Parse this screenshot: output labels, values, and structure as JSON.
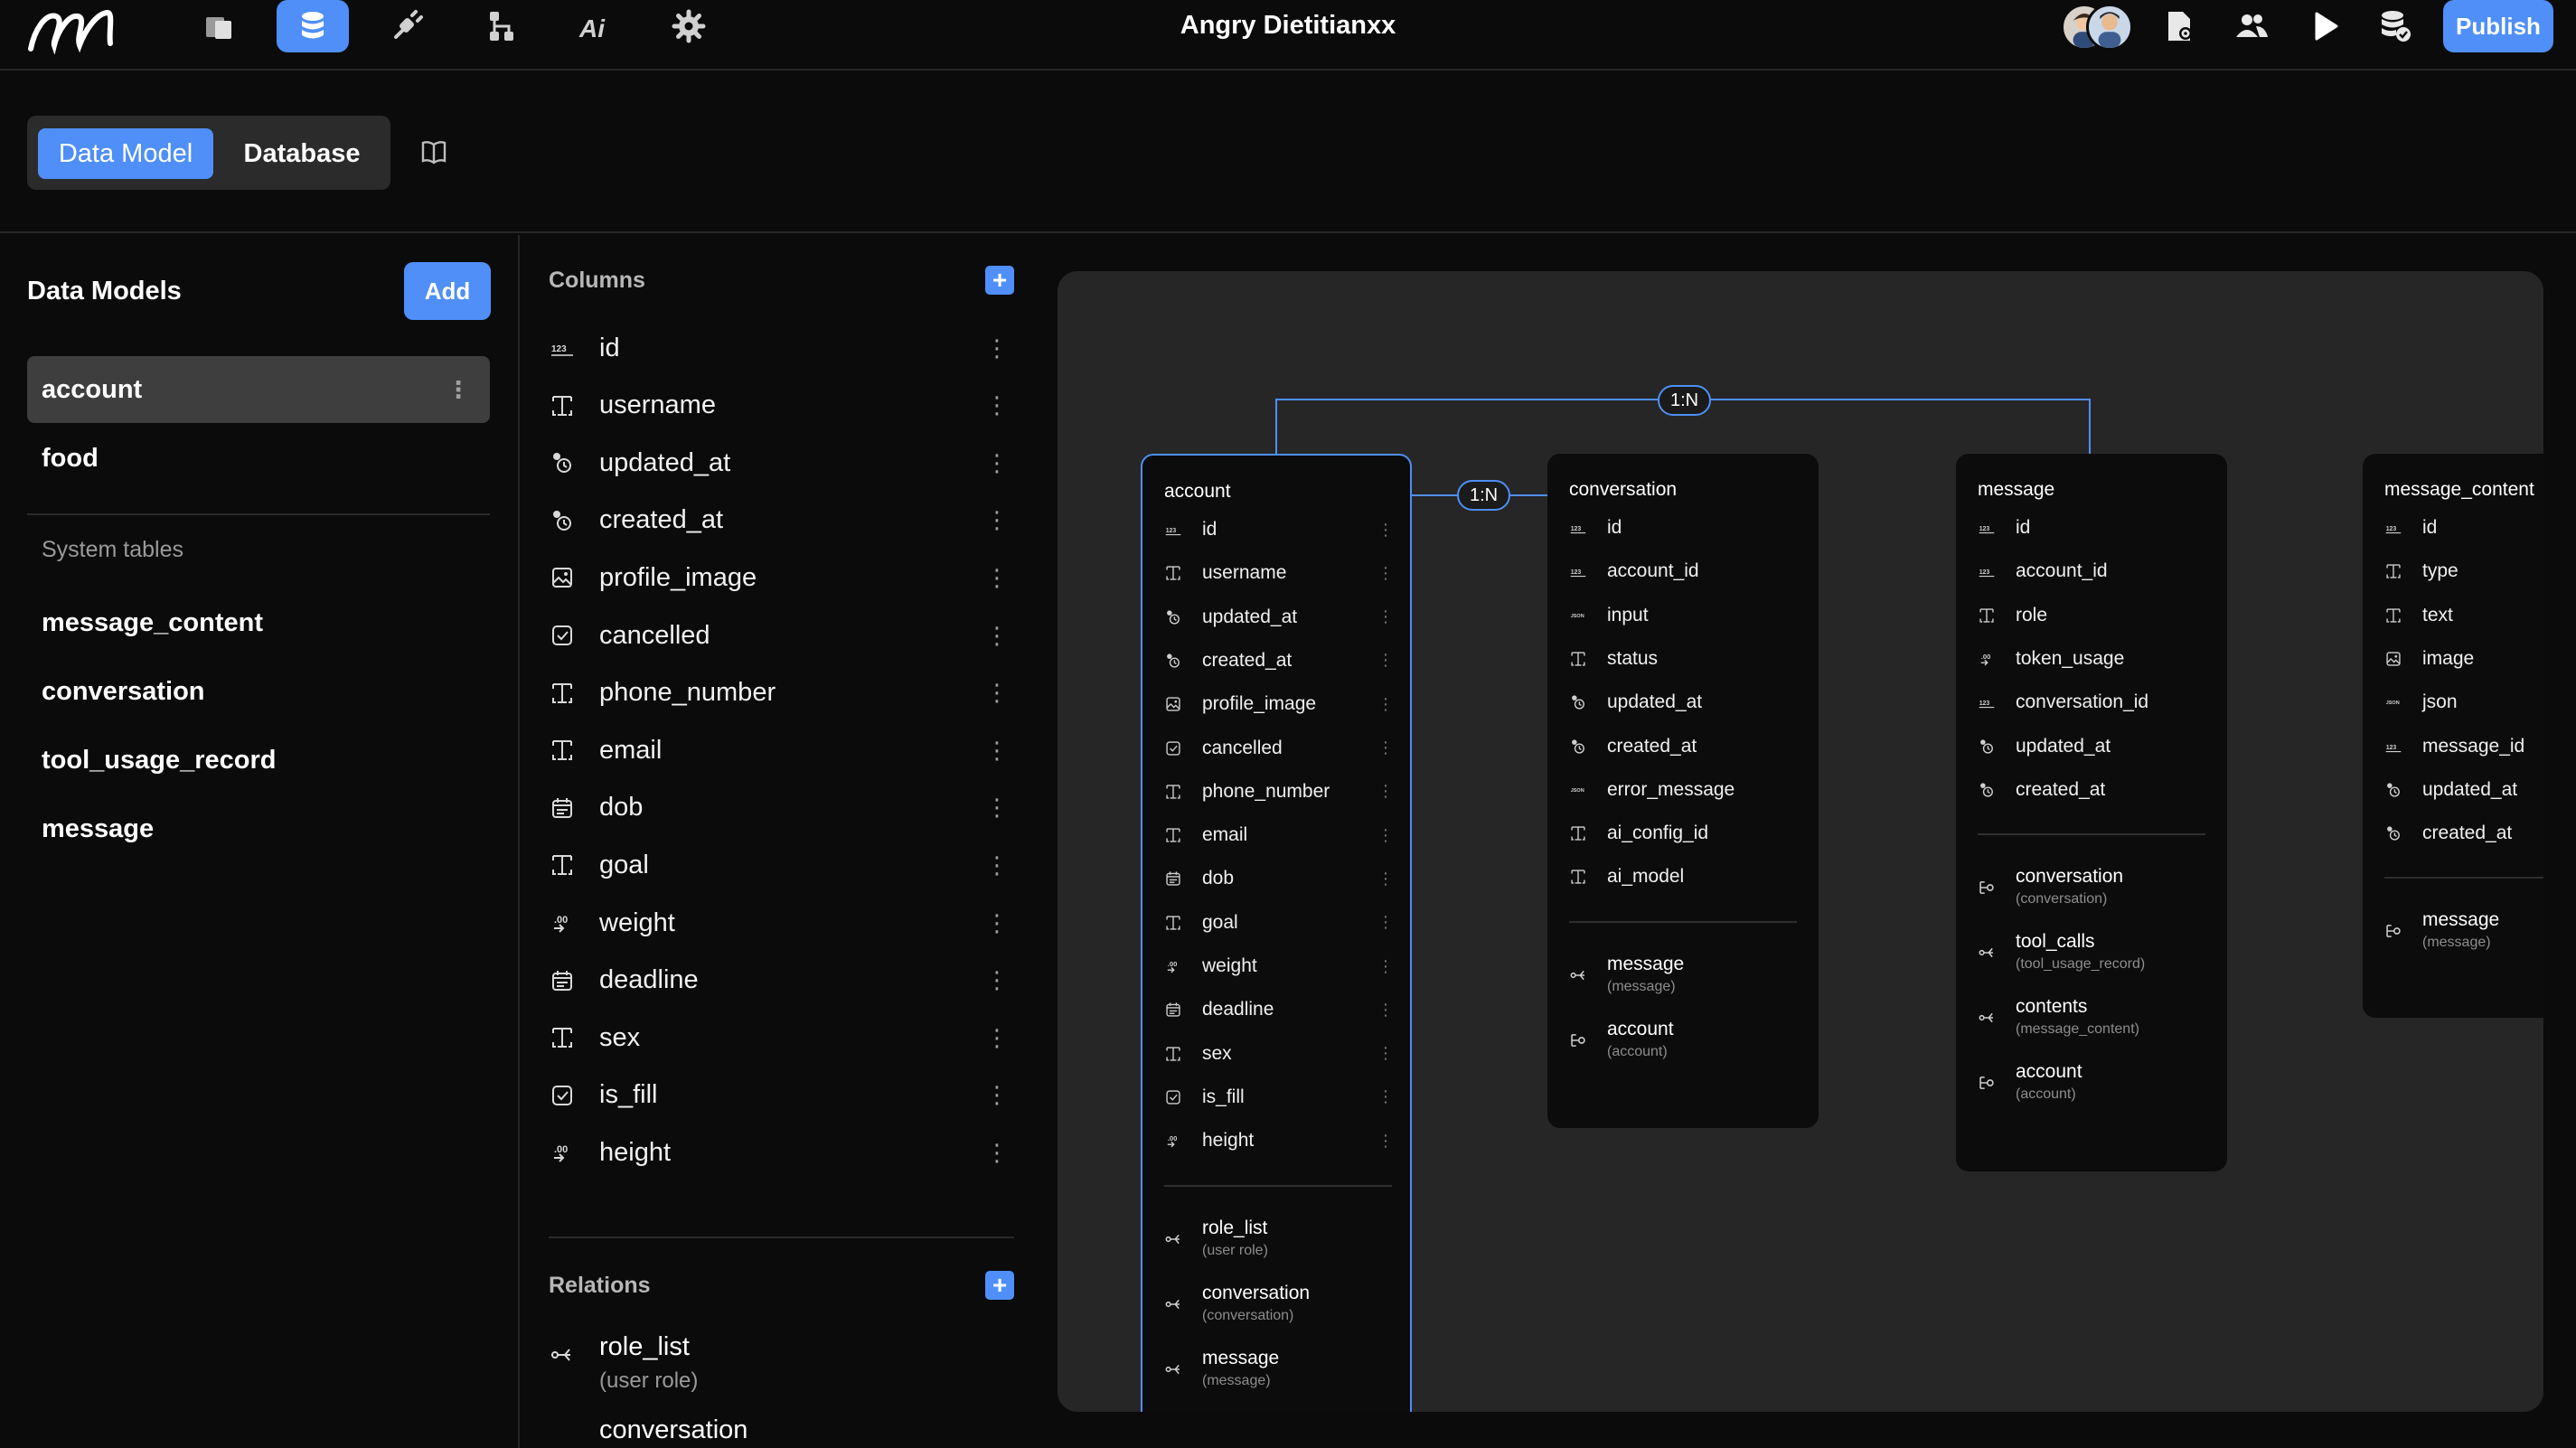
{
  "app": {
    "title": "Angry Dietitianxx",
    "publish_label": "Publish",
    "accent": "#4f8ff7"
  },
  "topbar": {
    "icons": [
      "pages-icon",
      "database-icon",
      "plug-icon",
      "workflow-icon",
      "ai-icon",
      "settings-icon"
    ],
    "right_icons": [
      "file-settings-icon",
      "users-icon",
      "play-icon",
      "database-check-icon"
    ]
  },
  "subheader": {
    "tab_data_model": "Data Model",
    "tab_database": "Database"
  },
  "models": {
    "title": "Data Models",
    "add_label": "Add",
    "items": [
      "account",
      "food"
    ],
    "system_label": "System tables",
    "system_items": [
      "message_content",
      "conversation",
      "tool_usage_record",
      "message"
    ]
  },
  "columns": {
    "title": "Columns",
    "items": [
      {
        "name": "id",
        "type": "number"
      },
      {
        "name": "username",
        "type": "text"
      },
      {
        "name": "updated_at",
        "type": "timestamp"
      },
      {
        "name": "created_at",
        "type": "timestamp"
      },
      {
        "name": "profile_image",
        "type": "image"
      },
      {
        "name": "cancelled",
        "type": "boolean"
      },
      {
        "name": "phone_number",
        "type": "text"
      },
      {
        "name": "email",
        "type": "text"
      },
      {
        "name": "dob",
        "type": "date"
      },
      {
        "name": "goal",
        "type": "text"
      },
      {
        "name": "weight",
        "type": "decimal"
      },
      {
        "name": "deadline",
        "type": "date"
      },
      {
        "name": "sex",
        "type": "text"
      },
      {
        "name": "is_fill",
        "type": "boolean"
      },
      {
        "name": "height",
        "type": "decimal"
      }
    ]
  },
  "relations": {
    "title": "Relations",
    "items": [
      {
        "name": "role_list",
        "target": "(user role)"
      },
      {
        "name": "conversation",
        "target": ""
      }
    ]
  },
  "diagram": {
    "badges": [
      "1:N",
      "1:N"
    ],
    "tables": [
      {
        "title": "account",
        "columns": [
          {
            "name": "id",
            "type": "number"
          },
          {
            "name": "username",
            "type": "text"
          },
          {
            "name": "updated_at",
            "type": "timestamp"
          },
          {
            "name": "created_at",
            "type": "timestamp"
          },
          {
            "name": "profile_image",
            "type": "image"
          },
          {
            "name": "cancelled",
            "type": "boolean"
          },
          {
            "name": "phone_number",
            "type": "text"
          },
          {
            "name": "email",
            "type": "text"
          },
          {
            "name": "dob",
            "type": "date"
          },
          {
            "name": "goal",
            "type": "text"
          },
          {
            "name": "weight",
            "type": "decimal"
          },
          {
            "name": "deadline",
            "type": "date"
          },
          {
            "name": "sex",
            "type": "text"
          },
          {
            "name": "is_fill",
            "type": "boolean"
          },
          {
            "name": "height",
            "type": "decimal"
          }
        ],
        "relations": [
          {
            "name": "role_list",
            "target": "(user role)",
            "kind": "many"
          },
          {
            "name": "conversation",
            "target": "(conversation)",
            "kind": "many"
          },
          {
            "name": "message",
            "target": "(message)",
            "kind": "many"
          }
        ]
      },
      {
        "title": "conversation",
        "columns": [
          {
            "name": "id",
            "type": "number"
          },
          {
            "name": "account_id",
            "type": "number"
          },
          {
            "name": "input",
            "type": "json"
          },
          {
            "name": "status",
            "type": "text"
          },
          {
            "name": "updated_at",
            "type": "timestamp"
          },
          {
            "name": "created_at",
            "type": "timestamp"
          },
          {
            "name": "error_message",
            "type": "json"
          },
          {
            "name": "ai_config_id",
            "type": "text"
          },
          {
            "name": "ai_model",
            "type": "text"
          }
        ],
        "relations": [
          {
            "name": "message",
            "target": "(message)",
            "kind": "many"
          },
          {
            "name": "account",
            "target": "(account)",
            "kind": "one"
          }
        ]
      },
      {
        "title": "message",
        "columns": [
          {
            "name": "id",
            "type": "number"
          },
          {
            "name": "account_id",
            "type": "number"
          },
          {
            "name": "role",
            "type": "text"
          },
          {
            "name": "token_usage",
            "type": "decimal"
          },
          {
            "name": "conversation_id",
            "type": "number"
          },
          {
            "name": "updated_at",
            "type": "timestamp"
          },
          {
            "name": "created_at",
            "type": "timestamp"
          }
        ],
        "relations": [
          {
            "name": "conversation",
            "target": "(conversation)",
            "kind": "one"
          },
          {
            "name": "tool_calls",
            "target": "(tool_usage_record)",
            "kind": "many"
          },
          {
            "name": "contents",
            "target": "(message_content)",
            "kind": "many"
          },
          {
            "name": "account",
            "target": "(account)",
            "kind": "one"
          }
        ]
      },
      {
        "title": "message_content",
        "columns": [
          {
            "name": "id",
            "type": "number"
          },
          {
            "name": "type",
            "type": "text"
          },
          {
            "name": "text",
            "type": "text"
          },
          {
            "name": "image",
            "type": "image"
          },
          {
            "name": "json",
            "type": "json"
          },
          {
            "name": "message_id",
            "type": "number"
          },
          {
            "name": "updated_at",
            "type": "timestamp"
          },
          {
            "name": "created_at",
            "type": "timestamp"
          }
        ],
        "relations": [
          {
            "name": "message",
            "target": "(message)",
            "kind": "one"
          }
        ]
      }
    ]
  }
}
